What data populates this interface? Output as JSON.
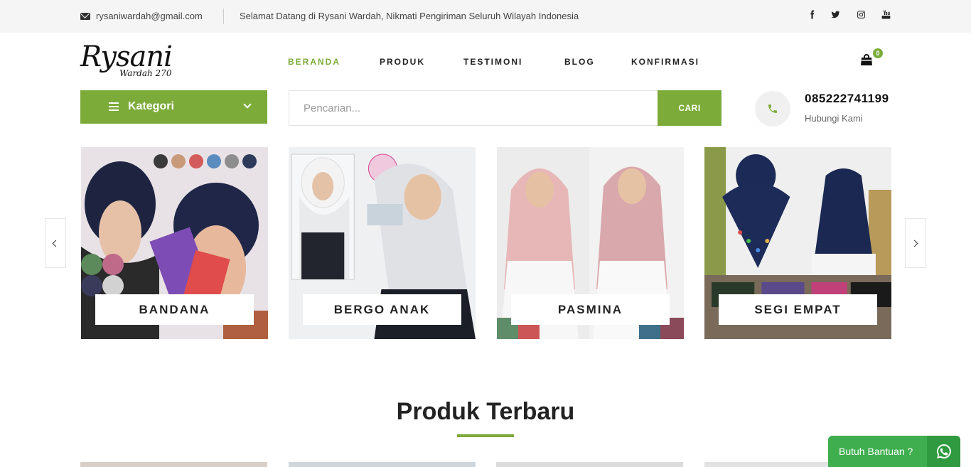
{
  "topbar": {
    "email": "rysaniwardah@gmail.com",
    "welcome": "Selamat Datang di Rysani Wardah, Nikmati Pengiriman Seluruh Wilayah Indonesia",
    "social": [
      "facebook-icon",
      "twitter-icon",
      "instagram-icon",
      "youtube-icon"
    ]
  },
  "logo": {
    "main": "Rysani",
    "sub": "Wardah 270"
  },
  "nav": [
    {
      "label": "BERANDA",
      "active": true
    },
    {
      "label": "PRODUK",
      "active": false
    },
    {
      "label": "TESTIMONI",
      "active": false
    },
    {
      "label": "BLOG",
      "active": false
    },
    {
      "label": "KONFIRMASI",
      "active": false
    }
  ],
  "cart": {
    "count": "0"
  },
  "kategori": {
    "label": "Kategori"
  },
  "search": {
    "placeholder": "Pencarian...",
    "button": "CARI"
  },
  "contact": {
    "phone": "085222741199",
    "label": "Hubungi Kami"
  },
  "categories": [
    {
      "label": "BANDANA"
    },
    {
      "label": "BERGO ANAK"
    },
    {
      "label": "PASMINA"
    },
    {
      "label": "SEGI EMPAT"
    }
  ],
  "section": {
    "title": "Produk Terbaru"
  },
  "help": {
    "label": "Butuh Bantuan ?"
  },
  "colors": {
    "accent": "#7cab3a",
    "whatsapp": "#3fae4f"
  }
}
